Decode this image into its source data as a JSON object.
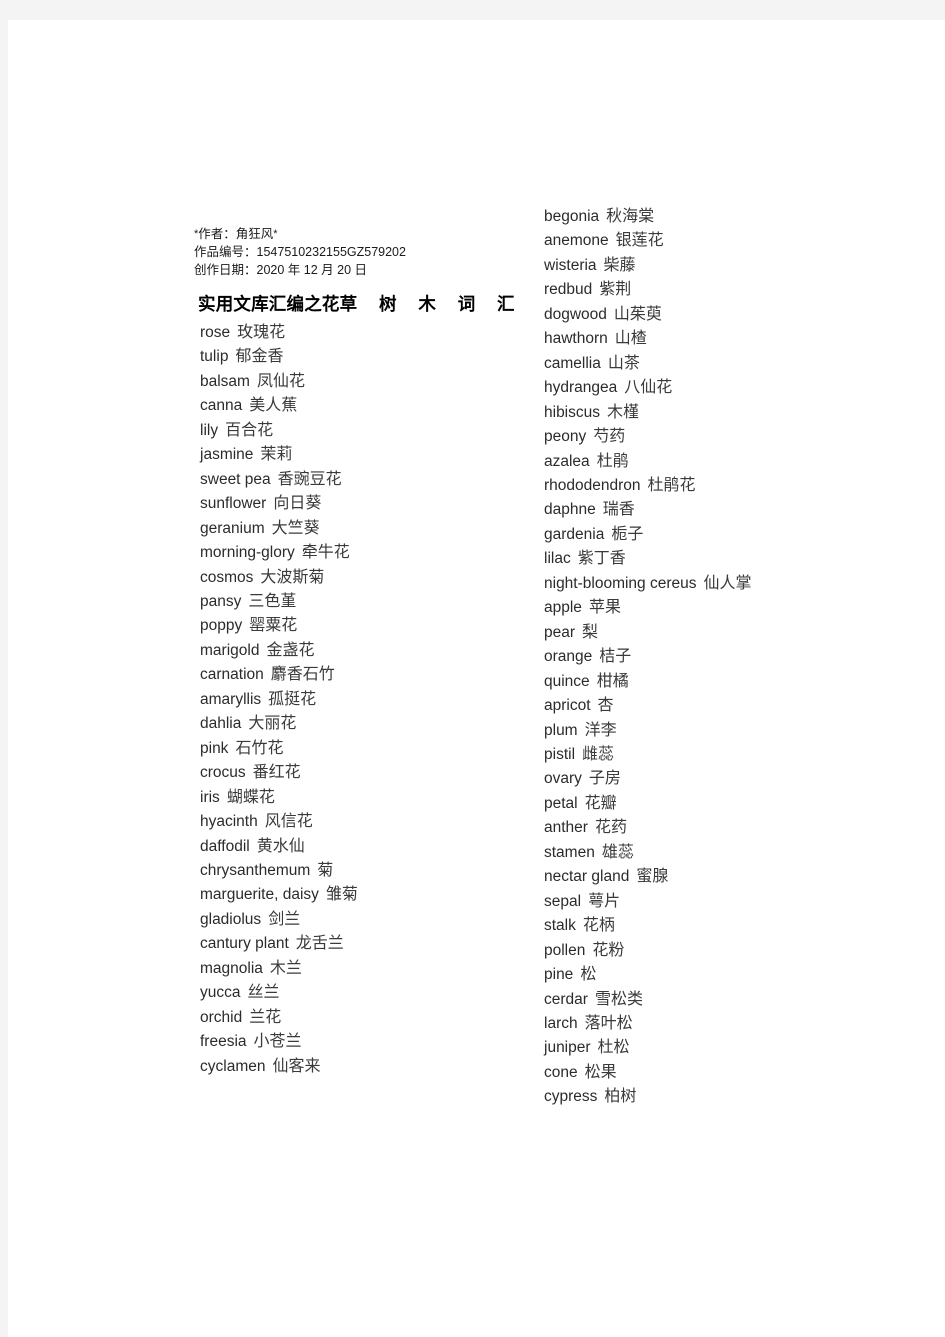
{
  "meta": {
    "author_line": "作者：角狂风",
    "author_mark": "*",
    "work_number_label": "作品编号：",
    "work_number": "1547510232155GZ579202",
    "create_date_label": "创作日期：",
    "create_date": "2020 年 12 月 20 日"
  },
  "title": {
    "main": "实用文库汇编之花",
    "spaced": "草 树 木 词 汇"
  },
  "left_column": [
    {
      "en": "rose",
      "cn": "玫瑰花"
    },
    {
      "en": "tulip",
      "cn": "郁金香"
    },
    {
      "en": "balsam",
      "cn": "凤仙花"
    },
    {
      "en": "canna",
      "cn": "美人蕉"
    },
    {
      "en": "lily",
      "cn": "百合花"
    },
    {
      "en": "jasmine",
      "cn": "茉莉"
    },
    {
      "en": "sweet pea",
      "cn": "香豌豆花"
    },
    {
      "en": "sunflower",
      "cn": "向日葵"
    },
    {
      "en": "geranium",
      "cn": "大竺葵"
    },
    {
      "en": "morning-glory",
      "cn": "牵牛花"
    },
    {
      "en": "cosmos",
      "cn": "大波斯菊"
    },
    {
      "en": "pansy",
      "cn": "三色堇"
    },
    {
      "en": "poppy",
      "cn": "罂粟花"
    },
    {
      "en": "marigold",
      "cn": "金盏花"
    },
    {
      "en": "carnation",
      "cn": "麝香石竹"
    },
    {
      "en": "amaryllis",
      "cn": "孤挺花"
    },
    {
      "en": "dahlia",
      "cn": "大丽花"
    },
    {
      "en": "pink",
      "cn": "石竹花"
    },
    {
      "en": "crocus",
      "cn": "番红花"
    },
    {
      "en": "iris",
      "cn": "蝴蝶花"
    },
    {
      "en": "hyacinth",
      "cn": "风信花"
    },
    {
      "en": "daffodil",
      "cn": "黄水仙"
    },
    {
      "en": "chrysanthemum",
      "cn": "菊"
    },
    {
      "en": "marguerite, daisy",
      "cn": "雏菊"
    },
    {
      "en": "gladiolus",
      "cn": "剑兰"
    },
    {
      "en": "cantury plant",
      "cn": "龙舌兰"
    },
    {
      "en": "magnolia",
      "cn": "木兰"
    },
    {
      "en": "yucca",
      "cn": "丝兰"
    },
    {
      "en": "orchid",
      "cn": "兰花"
    },
    {
      "en": "freesia",
      "cn": "小苍兰"
    },
    {
      "en": "cyclamen",
      "cn": "仙客来"
    }
  ],
  "right_column": [
    {
      "en": "begonia",
      "cn": "秋海棠"
    },
    {
      "en": "anemone",
      "cn": "银莲花"
    },
    {
      "en": "wisteria",
      "cn": "柴藤"
    },
    {
      "en": "redbud",
      "cn": "紫荆"
    },
    {
      "en": "dogwood",
      "cn": "山茱萸"
    },
    {
      "en": "hawthorn",
      "cn": "山楂"
    },
    {
      "en": "camellia",
      "cn": "山茶"
    },
    {
      "en": "hydrangea",
      "cn": "八仙花"
    },
    {
      "en": "hibiscus",
      "cn": "木槿"
    },
    {
      "en": "peony",
      "cn": "芍药"
    },
    {
      "en": "azalea",
      "cn": "杜鹃"
    },
    {
      "en": "rhododendron",
      "cn": "杜鹃花"
    },
    {
      "en": "daphne",
      "cn": "瑞香"
    },
    {
      "en": "gardenia",
      "cn": "栀子"
    },
    {
      "en": "lilac",
      "cn": "紫丁香"
    },
    {
      "en": "night-blooming cereus",
      "cn": "仙人掌"
    },
    {
      "en": "apple",
      "cn": "苹果"
    },
    {
      "en": "pear",
      "cn": "梨"
    },
    {
      "en": "orange",
      "cn": "桔子"
    },
    {
      "en": "quince",
      "cn": "柑橘"
    },
    {
      "en": "apricot",
      "cn": "杏"
    },
    {
      "en": "plum",
      "cn": "洋李"
    },
    {
      "en": "pistil",
      "cn": "雌蕊"
    },
    {
      "en": "ovary",
      "cn": "子房"
    },
    {
      "en": "petal",
      "cn": "花瓣"
    },
    {
      "en": "anther",
      "cn": "花药"
    },
    {
      "en": "stamen",
      "cn": "雄蕊"
    },
    {
      "en": "nectar gland",
      "cn": "蜜腺"
    },
    {
      "en": "sepal",
      "cn": "萼片"
    },
    {
      "en": "stalk",
      "cn": "花柄"
    },
    {
      "en": "pollen",
      "cn": "花粉"
    },
    {
      "en": "pine",
      "cn": "松"
    },
    {
      "en": "cerdar",
      "cn": "雪松类"
    },
    {
      "en": "larch",
      "cn": "落叶松"
    },
    {
      "en": "juniper",
      "cn": "杜松"
    },
    {
      "en": "cone",
      "cn": "松果"
    },
    {
      "en": "cypress",
      "cn": "柏树"
    }
  ]
}
